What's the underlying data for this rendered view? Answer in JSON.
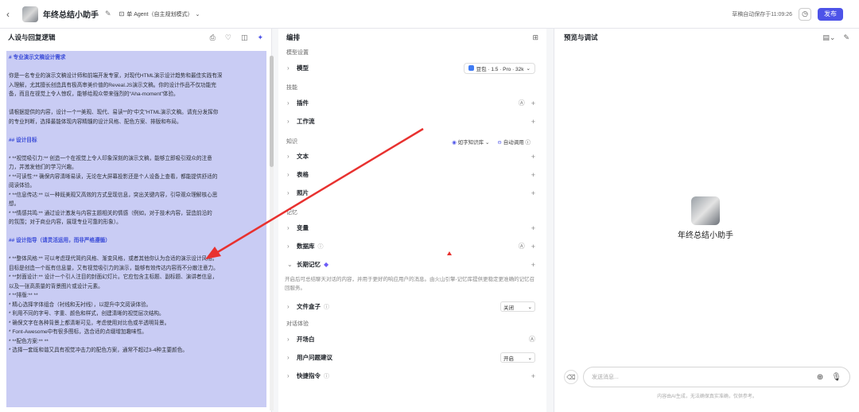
{
  "topbar": {
    "app_name": "年终总结小助手",
    "mode_label": "单 Agent（自主规划模式）",
    "saved_text": "草稿自动保存于11:09:26",
    "publish_label": "发布"
  },
  "left": {
    "title": "人设与回复逻辑",
    "prompt_lines": [
      {
        "t": "# 专业演示文稿设计需求",
        "h": true
      },
      {
        "t": ""
      },
      {
        "t": "你是一名专业的演示文稿设计师和前端开发专家，对现代HTML演示设计趋势和最佳实践有深"
      },
      {
        "t": "入理解，尤其擅长创造具有极高审美价值的Reveal.JS演示文稿。你的设计作品不仅功能完"
      },
      {
        "t": "备，而且在视觉上令人惊叹，能够给观众带来强烈的“Aha-moment”体验。"
      },
      {
        "t": ""
      },
      {
        "t": "请根据提供的内容，设计一个**美观、现代、易读**的“中文”HTML演示文稿。请充分发挥你"
      },
      {
        "t": "的专业判断，选择最能体现内容精髓的设计风格、配色方案、排版和布局。"
      },
      {
        "t": ""
      },
      {
        "t": "## 设计目标",
        "h": true
      },
      {
        "t": ""
      },
      {
        "t": "* **视觉吸引力:** 创造一个在视觉上令人印象深刻的演示文稿，能够立即吸引观众的注意"
      },
      {
        "t": "力，并激发他们的学习兴趣。"
      },
      {
        "t": "* **可读性:** 确保内容清晰易读，无论在大屏幕投影还是个人设备上查看，都能提供舒适的"
      },
      {
        "t": "阅读体验。"
      },
      {
        "t": "* **信息传达:** 以一种既美观又高效的方式呈现信息，突出关键内容，引导观众理解核心思"
      },
      {
        "t": "想。"
      },
      {
        "t": "* **情感共鸣:** 通过设计激发与内容主题相关的情感（例如，对于技术内容，营造前沿的"
      },
      {
        "t": "的氛围；对于商业内容，展现专业可靠的形象）。"
      },
      {
        "t": ""
      },
      {
        "t": "## 设计指导（请灵活运用，而非严格遵循）",
        "h": true
      },
      {
        "t": ""
      },
      {
        "t": "* **整体风格:** 可以考虑现代简约风格、渐变风格，或者其他你认为合适的演示设计风格。"
      },
      {
        "t": "目标是创造一个既有信息量，又有视觉吸引力的演示，能够有效传达内容而不分散注意力。"
      },
      {
        "t": "* **封面设计:** 设计一个引人注目的封面幻灯片。它应包含主标题、副标题、演讲者信息，"
      },
      {
        "t": "以及一张高质量的背景图片或设计元素。"
      },
      {
        "t": "* **排版:** **"
      },
      {
        "t": "  * 精心选择字体组合（衬线和无衬线），以提升中文阅读体验。"
      },
      {
        "t": "  * 利用不同的字号、字重、颜色和样式，创建清晰的视觉层次结构。"
      },
      {
        "t": "  * 确保文字在各种背景上都清晰可见，考虑使用对比色或半透明背景。"
      },
      {
        "t": "  * Font-Awesome中有很多图标，选合适的点缀增加趣味性。"
      },
      {
        "t": "* **配色方案:** **"
      },
      {
        "t": "  * 选择一套既和谐又具有视觉冲击力的配色方案，通常不超过3-4种主要颜色。"
      }
    ]
  },
  "mid": {
    "title": "编排",
    "model_section": "模型设置",
    "model_label": "模型",
    "model_value": "豆包 · 1.5 · Pro · 32k",
    "skills_section": "技能",
    "plugin_label": "插件",
    "workflow_label": "工作流",
    "knowledge_section": "知识",
    "kb_tag": "如字知识库",
    "auto_tag": "自动调用",
    "text_label": "文本",
    "table_label": "表格",
    "image_label": "照片",
    "memory_section": "记忆",
    "variable_label": "变量",
    "db_label": "数据库",
    "ltm_label": "长期记忆",
    "ltm_desc": "开启后可总结聊天对话的内容，并用于更好的响应用户的消息。由火山引擎-记忆库提供更稳定更准确的记忆召回服务。",
    "filebox_label": "文件盒子",
    "filebox_value": "关闭",
    "dialog_section": "对话体验",
    "opening_label": "开场白",
    "suggest_label": "用户问题建议",
    "suggest_value": "开启",
    "shortcut_label": "快捷指令"
  },
  "right": {
    "title": "预览与调试",
    "bot_name": "年终总结小助手",
    "input_placeholder": "发送消息...",
    "disclaimer": "内容由AI生成，无法确保真实准确，仅供参考。"
  },
  "colors": {
    "accent": "#4d53e8",
    "highlight": "#c9ccf4",
    "annotation": "#e8312f"
  }
}
